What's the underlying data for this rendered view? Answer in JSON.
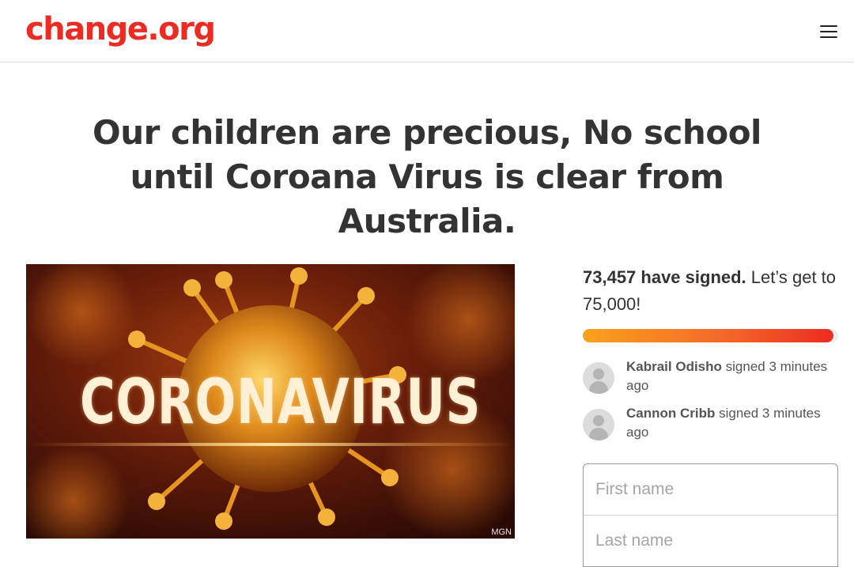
{
  "header": {
    "logo": "change.org",
    "menu_icon": "hamburger-menu-icon"
  },
  "petition": {
    "title": "Our children are precious, No school until Coroana Virus is clear from Australia."
  },
  "hero": {
    "caption": "CORONAVIRUS",
    "credit": "MGN"
  },
  "signatures": {
    "count": "73,457 have signed.",
    "goal_text": " Let’s get to 75,000!",
    "progress_fraction": 0.98,
    "recent": [
      {
        "name": "Kabrail Odisho",
        "action": " signed 3 minutes ago"
      },
      {
        "name": "Cannon Cribb",
        "action": " signed 3 minutes ago"
      }
    ]
  },
  "form": {
    "first_name_placeholder": "First name",
    "last_name_placeholder": "Last name"
  },
  "colors": {
    "brand": "#ec2c22",
    "progress_start": "#f8a21b",
    "progress_end": "#ec2c22"
  }
}
